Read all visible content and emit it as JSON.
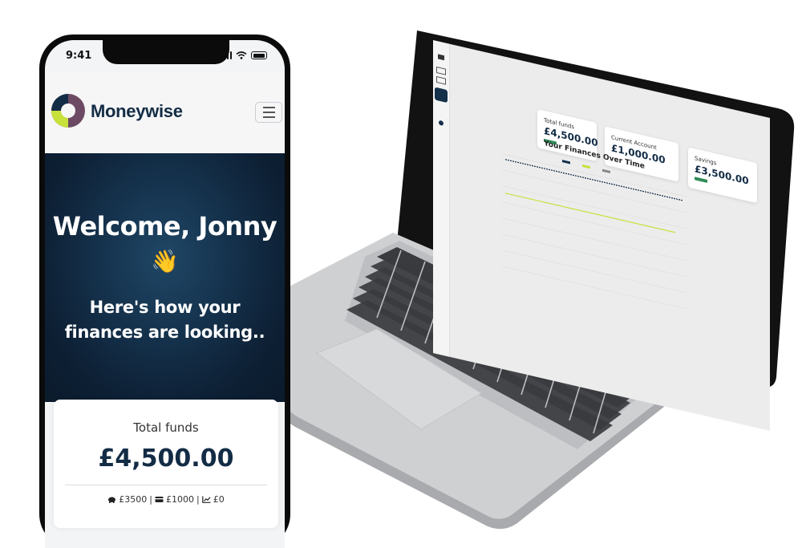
{
  "colors": {
    "navy": "#132c45",
    "hero_dark": "#0d1f33",
    "logo_green": "#c8e03a",
    "logo_purple": "#6d4a63",
    "chart_line_dark": "#14304a",
    "chart_line_green": "#c8e03a",
    "badge_green": "#2e8b57"
  },
  "phone": {
    "status_bar": {
      "time": "9:41",
      "icons": [
        "signal-icon",
        "wifi-icon",
        "battery-icon"
      ]
    },
    "navbar": {
      "brand": "Moneywise",
      "menu_icon": "hamburger-icon"
    },
    "hero": {
      "heading": "Welcome, Jonny",
      "wave_emoji": "👋",
      "subheading": "Here's how your finances are looking.."
    },
    "funds_card": {
      "label": "Total funds",
      "amount": "£4,500.00",
      "breakdown": [
        {
          "icon": "piggy-bank-icon",
          "text": "£3500"
        },
        {
          "icon": "credit-card-icon",
          "text": "£1000"
        },
        {
          "icon": "chart-line-icon",
          "text": "£0"
        }
      ],
      "separator": "|"
    }
  },
  "laptop": {
    "sidebar_icons": [
      "home-icon",
      "wallet-icon",
      "chart-icon",
      "savings-icon",
      "info-icon"
    ],
    "cards": [
      {
        "title": "Total funds",
        "value": "£4,500.00"
      },
      {
        "title": "Current Account",
        "value": "£1,000.00"
      },
      {
        "title": "Savings",
        "value": "£3,500.00"
      }
    ],
    "chart": {
      "title": "Your Finances Over Time"
    }
  }
}
